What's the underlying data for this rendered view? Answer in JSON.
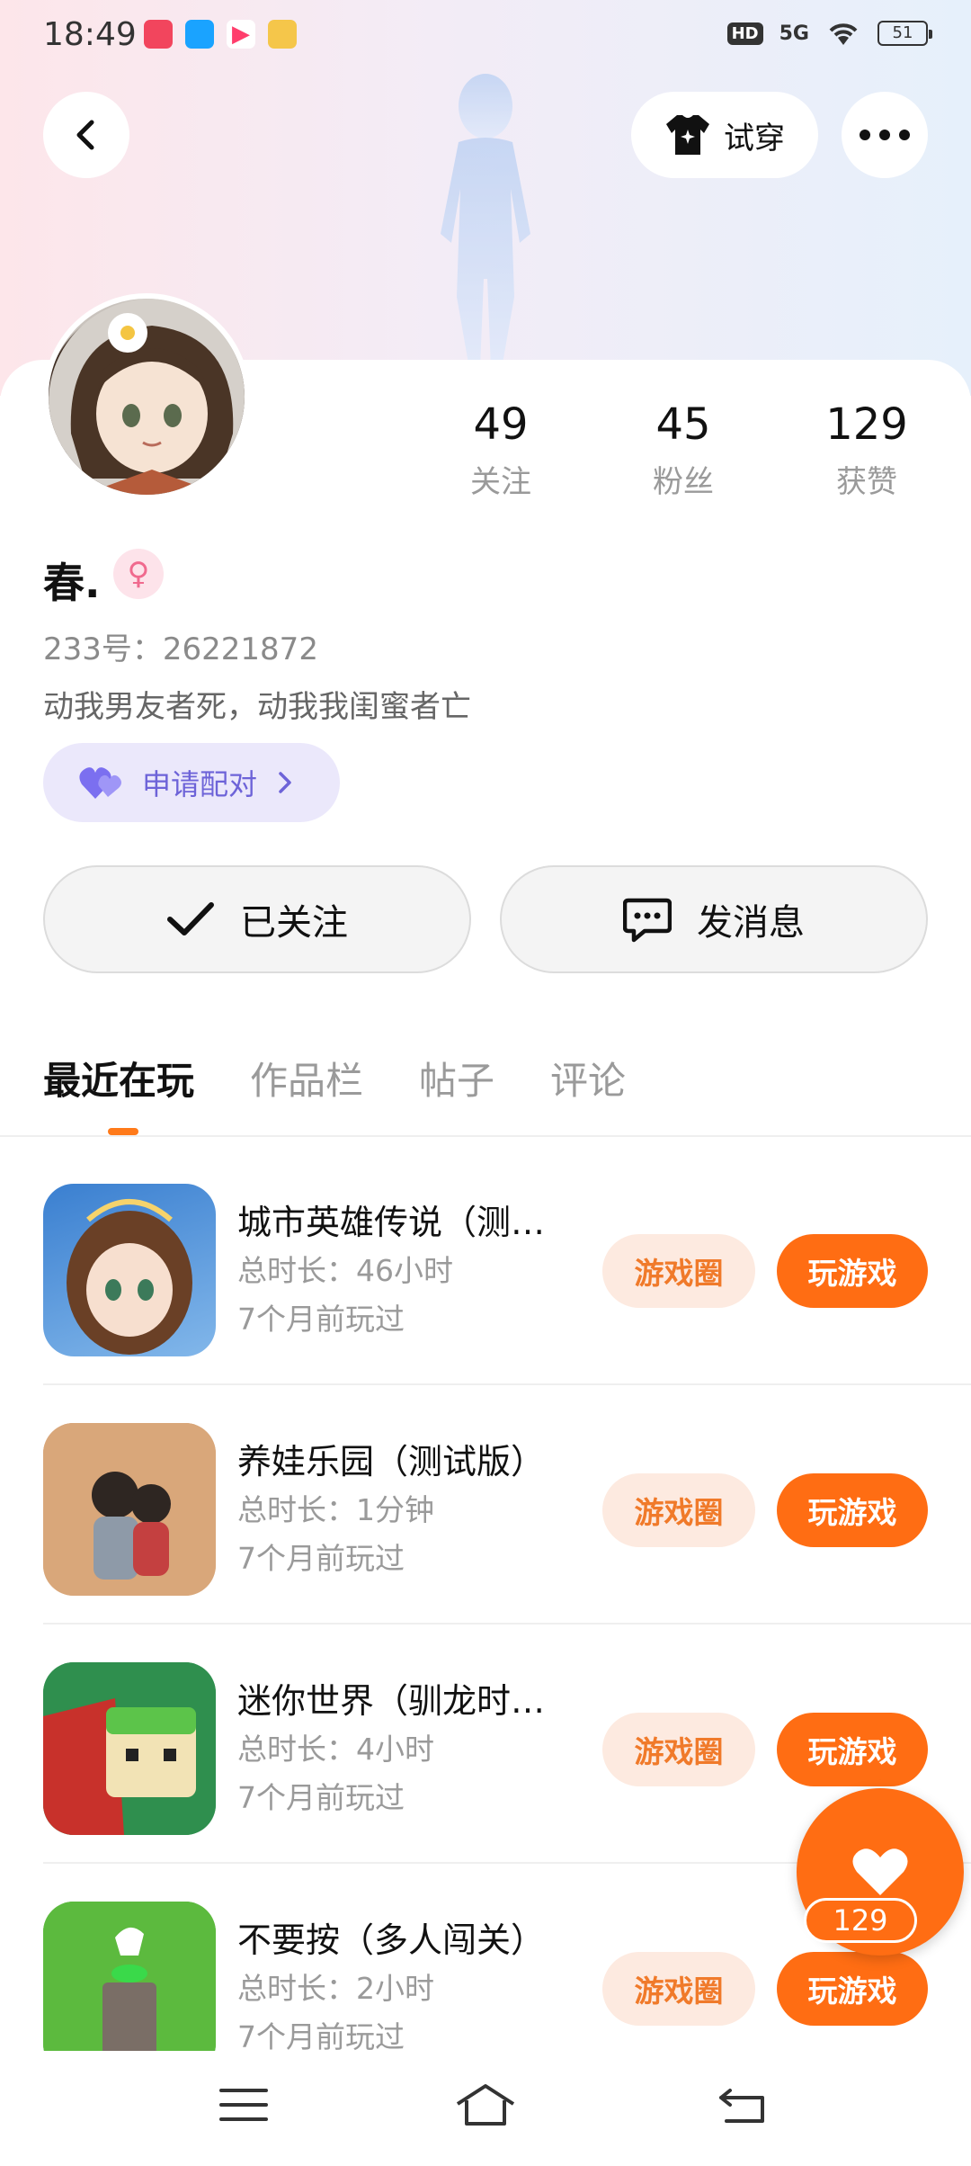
{
  "status_bar": {
    "time": "18:49",
    "network": "5G",
    "battery": "51"
  },
  "header": {
    "tryon_label": "试穿"
  },
  "profile": {
    "username": "春.",
    "gender_icon": "female-icon",
    "uid": "233号：26221872",
    "bio": "动我男友者死，动我我闺蜜者亡",
    "pair_label": "申请配对",
    "stats": [
      {
        "num": "49",
        "label": "关注"
      },
      {
        "num": "45",
        "label": "粉丝"
      },
      {
        "num": "129",
        "label": "获赞"
      }
    ],
    "follow_label": "已关注",
    "message_label": "发消息"
  },
  "tabs": [
    {
      "label": "最近在玩",
      "active": true
    },
    {
      "label": "作品栏",
      "active": false
    },
    {
      "label": "帖子",
      "active": false
    },
    {
      "label": "评论",
      "active": false
    }
  ],
  "games": [
    {
      "name": "城市英雄传说（测…",
      "duration": "总时长：46小时",
      "last_played": "7个月前玩过",
      "circle_label": "游戏圈",
      "play_label": "玩游戏"
    },
    {
      "name": "养娃乐园（测试版）",
      "duration": "总时长：1分钟",
      "last_played": "7个月前玩过",
      "circle_label": "游戏圈",
      "play_label": "玩游戏"
    },
    {
      "name": "迷你世界（驯龙时…",
      "duration": "总时长：4小时",
      "last_played": "7个月前玩过",
      "circle_label": "游戏圈",
      "play_label": "玩游戏"
    },
    {
      "name": "不要按（多人闯关）",
      "duration": "总时长：2小时",
      "last_played": "7个月前玩过",
      "circle_label": "游戏圈",
      "play_label": "玩游戏"
    }
  ],
  "floating": {
    "like_count": "129"
  },
  "colors": {
    "accent": "#ff6d13",
    "pair_purple": "#6d63d8"
  }
}
